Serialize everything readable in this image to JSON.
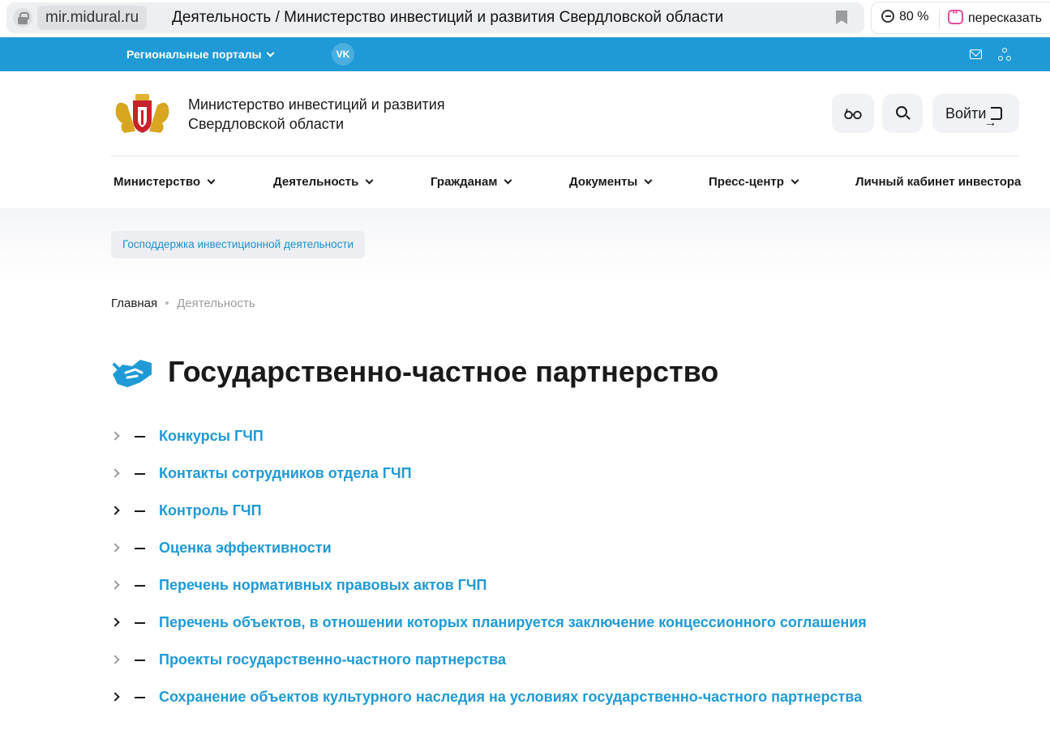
{
  "browser": {
    "domain": "mir.midural.ru",
    "tab_title": "Деятельность / Министерство инвестиций и развития Свердловской области",
    "zoom": "80 %",
    "retell_label": "пересказать"
  },
  "topbar": {
    "portals_label": "Региональные порталы",
    "vk_label": "VK"
  },
  "header": {
    "org_line1": "Министерство инвестиций и развития",
    "org_line2": "Свердловской области",
    "login_label": "Войти"
  },
  "nav": {
    "items": [
      {
        "label": "Министерство"
      },
      {
        "label": "Деятельность"
      },
      {
        "label": "Гражданам"
      },
      {
        "label": "Документы"
      },
      {
        "label": "Пресс-центр"
      },
      {
        "label": "Личный кабинет инвестора"
      }
    ]
  },
  "tag_label": "Господдержка инвестиционной деятельности",
  "breadcrumb": {
    "home": "Главная",
    "current": "Деятельность"
  },
  "page_title": "Государственно-частное партнерство",
  "colors": {
    "accent": "#1f9ad6",
    "text": "#1a1a1a"
  },
  "links": [
    {
      "label": "Конкурсы ГЧП",
      "expandable_dark": false
    },
    {
      "label": "Контакты сотрудников отдела ГЧП",
      "expandable_dark": false
    },
    {
      "label": "Контроль ГЧП",
      "expandable_dark": true
    },
    {
      "label": "Оценка эффективности",
      "expandable_dark": false
    },
    {
      "label": "Перечень нормативных правовых актов ГЧП",
      "expandable_dark": false
    },
    {
      "label": "Перечень объектов, в отношении которых планируется заключение концессионного соглашения",
      "expandable_dark": true
    },
    {
      "label": "Проекты государственно-частного партнерства",
      "expandable_dark": false
    },
    {
      "label": "Сохранение объектов культурного наследия на условиях государственно-частного партнерства",
      "expandable_dark": true
    }
  ]
}
